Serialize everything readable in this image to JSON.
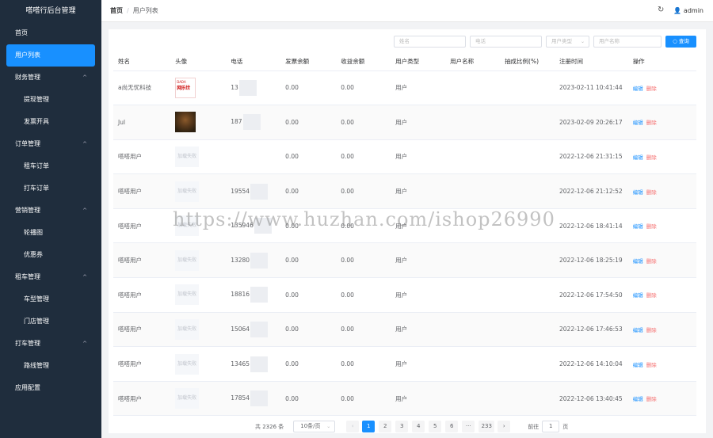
{
  "app": {
    "title": "嗒嗒行后台管理"
  },
  "sidebar": {
    "items": [
      {
        "label": "首页",
        "type": "item"
      },
      {
        "label": "用户列表",
        "type": "active"
      },
      {
        "label": "财务管理",
        "type": "group"
      },
      {
        "label": "提现管理",
        "type": "sub"
      },
      {
        "label": "发票开具",
        "type": "sub"
      },
      {
        "label": "订单管理",
        "type": "group"
      },
      {
        "label": "租车订单",
        "type": "sub"
      },
      {
        "label": "打车订单",
        "type": "sub"
      },
      {
        "label": "营销管理",
        "type": "group"
      },
      {
        "label": "轮播图",
        "type": "sub"
      },
      {
        "label": "优惠券",
        "type": "sub"
      },
      {
        "label": "租车管理",
        "type": "group"
      },
      {
        "label": "车型管理",
        "type": "sub"
      },
      {
        "label": "门店管理",
        "type": "sub"
      },
      {
        "label": "打车管理",
        "type": "group"
      },
      {
        "label": "路线管理",
        "type": "sub"
      },
      {
        "label": "应用配置",
        "type": "item"
      }
    ]
  },
  "header": {
    "breadcrumb_home": "首页",
    "breadcrumb_sep": "/",
    "breadcrumb_current": "用户列表",
    "refresh_icon": "↻",
    "user_icon": "👤",
    "username": "admin"
  },
  "filters": {
    "name_placeholder": "姓名",
    "phone_placeholder": "电话",
    "type_placeholder": "用户类型",
    "username_placeholder": "用户名称",
    "search_label": "查询",
    "search_icon": "○"
  },
  "table": {
    "columns": [
      "姓名",
      "头像",
      "电话",
      "发票余额",
      "收益余额",
      "用户类型",
      "用户名称",
      "抽成比例(%)",
      "注册时间",
      "操作"
    ],
    "edit_label": "编辑",
    "delete_label": "删除",
    "avatar_failed_label": "加载失败",
    "logo_text": "网乐世",
    "logo_sub": "DADA",
    "rows": [
      {
        "name": "a尚无忧科技",
        "avatar": "logo",
        "phone": "13",
        "invoice": "0.00",
        "income": "0.00",
        "type": "用户",
        "username": "",
        "ratio": "",
        "time": "2023-02-11 10:41:44"
      },
      {
        "name": "Jul",
        "avatar": "photo",
        "phone": "187",
        "invoice": "0.00",
        "income": "0.00",
        "type": "用户",
        "username": "",
        "ratio": "",
        "time": "2023-02-09 20:26:17"
      },
      {
        "name": "嗒嗒用户",
        "avatar": "failed",
        "phone": "",
        "invoice": "0.00",
        "income": "0.00",
        "type": "用户",
        "username": "",
        "ratio": "",
        "time": "2022-12-06 21:31:15"
      },
      {
        "name": "嗒嗒用户",
        "avatar": "failed",
        "phone": "19554",
        "invoice": "0.00",
        "income": "0.00",
        "type": "用户",
        "username": "",
        "ratio": "",
        "time": "2022-12-06 21:12:52"
      },
      {
        "name": "嗒嗒用户",
        "avatar": "failed",
        "phone": "135946",
        "invoice": "0.00",
        "income": "0.00",
        "type": "用户",
        "username": "",
        "ratio": "",
        "time": "2022-12-06 18:41:14"
      },
      {
        "name": "嗒嗒用户",
        "avatar": "failed",
        "phone": "13280",
        "invoice": "0.00",
        "income": "0.00",
        "type": "用户",
        "username": "",
        "ratio": "",
        "time": "2022-12-06 18:25:19"
      },
      {
        "name": "嗒嗒用户",
        "avatar": "failed",
        "phone": "18816",
        "invoice": "0.00",
        "income": "0.00",
        "type": "用户",
        "username": "",
        "ratio": "",
        "time": "2022-12-06 17:54:50"
      },
      {
        "name": "嗒嗒用户",
        "avatar": "failed",
        "phone": "15064",
        "invoice": "0.00",
        "income": "0.00",
        "type": "用户",
        "username": "",
        "ratio": "",
        "time": "2022-12-06 17:46:53"
      },
      {
        "name": "嗒嗒用户",
        "avatar": "failed",
        "phone": "13465",
        "invoice": "0.00",
        "income": "0.00",
        "type": "用户",
        "username": "",
        "ratio": "",
        "time": "2022-12-06 14:10:04"
      },
      {
        "name": "嗒嗒用户",
        "avatar": "failed",
        "phone": "17854",
        "invoice": "0.00",
        "income": "0.00",
        "type": "用户",
        "username": "",
        "ratio": "",
        "time": "2022-12-06 13:40:45"
      }
    ]
  },
  "pagination": {
    "total": "共 2326 条",
    "page_size": "10条/页",
    "prev": "‹",
    "next": "›",
    "pages": [
      "1",
      "2",
      "3",
      "4",
      "5",
      "6",
      "···",
      "233"
    ],
    "current": "1",
    "goto_label": "前往",
    "goto_value": "1",
    "page_unit": "页"
  },
  "watermark": "https://www.huzhan.com/ishop26990"
}
